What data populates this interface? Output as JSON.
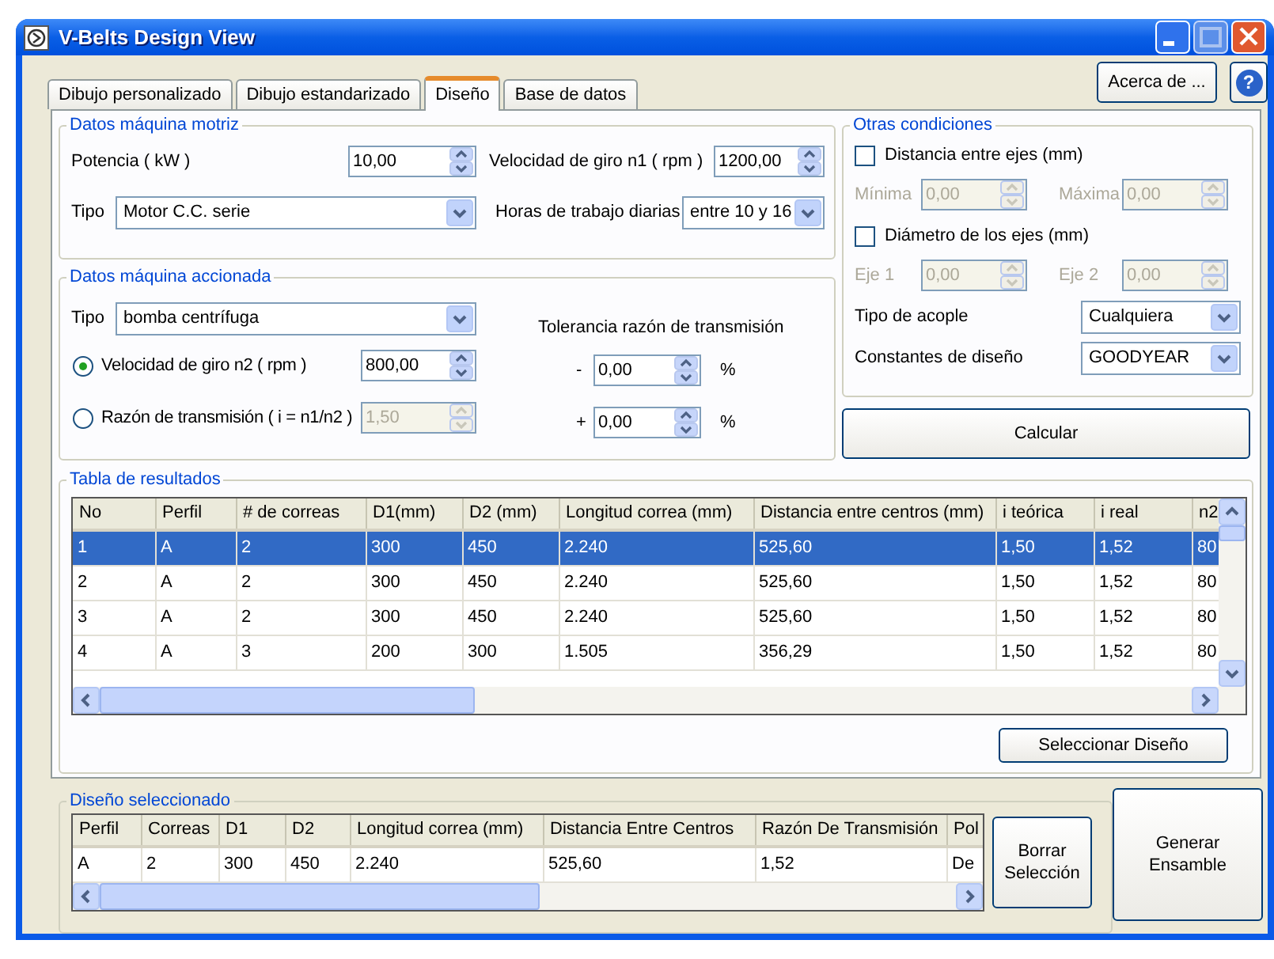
{
  "window": {
    "title": "V-Belts Design View"
  },
  "tabs": [
    {
      "label": "Dibujo personalizado",
      "selected": false
    },
    {
      "label": "Dibujo estandarizado",
      "selected": false
    },
    {
      "label": "Diseño",
      "selected": true
    },
    {
      "label": "Base de datos",
      "selected": false
    }
  ],
  "about_button": "Acerca de ...",
  "help_button": "?",
  "motriz": {
    "title": "Datos máquina motriz",
    "power": {
      "label": "Potencia ( kW )",
      "value": "10,00"
    },
    "speed": {
      "label": "Velocidad de giro n1 ( rpm )",
      "value": "1200,00"
    },
    "type": {
      "label": "Tipo",
      "value": "Motor C.C. serie"
    },
    "hours": {
      "label": "Horas de trabajo diarias",
      "value": "entre 10 y 16"
    }
  },
  "accionada": {
    "title": "Datos máquina accionada",
    "type": {
      "label": "Tipo",
      "value": "bomba centrífuga"
    },
    "options": [
      {
        "label": "Velocidad de giro n2 ( rpm )",
        "value": "800,00",
        "selected": true
      },
      {
        "label": "Razón de transmisión ( i = n1/n2 )",
        "value": "1,50",
        "selected": false
      }
    ],
    "tolerance": {
      "label": "Tolerancia razón de transmisión",
      "rows": [
        {
          "sign": "-",
          "value": "0,00",
          "unit": "%"
        },
        {
          "sign": "+",
          "value": "0,00",
          "unit": "%"
        }
      ]
    }
  },
  "otras": {
    "title": "Otras condiciones",
    "groups": [
      {
        "label": "Distancia entre ejes (mm)",
        "checked": false,
        "fields": [
          {
            "label": "Mínima",
            "value": "0,00"
          },
          {
            "label": "Máxima",
            "value": "0,00"
          }
        ]
      },
      {
        "label": "Diámetro de los ejes (mm)",
        "checked": false,
        "fields": [
          {
            "label": "Eje 1",
            "value": "0,00"
          },
          {
            "label": "Eje 2",
            "value": "0,00"
          }
        ]
      }
    ],
    "coupling": {
      "label": "Tipo de acople",
      "value": "Cualquiera"
    },
    "constants": {
      "label": "Constantes de diseño",
      "value": "GOODYEAR"
    }
  },
  "calculate_button": "Calcular",
  "results": {
    "title": "Tabla de resultados",
    "columns": [
      "No",
      "Perfil",
      "# de correas",
      "D1(mm)",
      "D2 (mm)",
      "Longitud correa (mm)",
      "Distancia entre centros (mm)",
      "i teórica",
      "i real",
      "n2"
    ],
    "rows": [
      {
        "cells": [
          "1",
          "A",
          "2",
          "300",
          "450",
          "2.240",
          "525,60",
          "1,50",
          "1,52",
          "80"
        ],
        "selected": true
      },
      {
        "cells": [
          "2",
          "A",
          "2",
          "300",
          "450",
          "2.240",
          "525,60",
          "1,50",
          "1,52",
          "80"
        ],
        "selected": false
      },
      {
        "cells": [
          "3",
          "A",
          "2",
          "300",
          "450",
          "2.240",
          "525,60",
          "1,50",
          "1,52",
          "80"
        ],
        "selected": false
      },
      {
        "cells": [
          "4",
          "A",
          "3",
          "200",
          "300",
          "1.505",
          "356,29",
          "1,50",
          "1,52",
          "80"
        ],
        "selected": false
      }
    ]
  },
  "select_button": "Seleccionar Diseño",
  "chosen": {
    "title": "Diseño seleccionado",
    "columns": [
      "Perfil",
      "Correas",
      "D1",
      "D2",
      "Longitud correa (mm)",
      "Distancia Entre Centros",
      "Razón De Transmisión",
      "Pol"
    ],
    "rows": [
      {
        "cells": [
          "A",
          "2",
          "300",
          "450",
          "2.240",
          "525,60",
          "1,52",
          "De"
        ]
      }
    ]
  },
  "clear_button": "Borrar Selección",
  "assemble_button": "Generar Ensamble"
}
